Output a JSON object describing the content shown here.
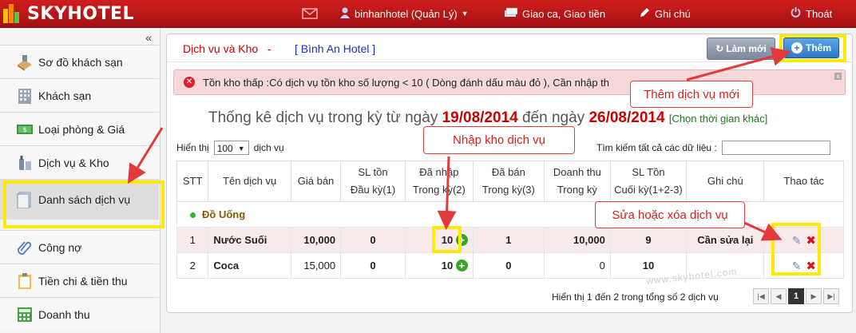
{
  "topbar": {
    "logo_text": "SKYHOTEL",
    "user": "binhanhotel (Quản Lý)",
    "shift": "Giao ca, Giao tiền",
    "notes": "Ghi chú",
    "logout": "Thoát"
  },
  "sidebar": {
    "collapse": "«",
    "items": [
      {
        "label": "Sơ đồ khách sạn"
      },
      {
        "label": "Khách sạn"
      },
      {
        "label": "Loại phòng & Giá"
      },
      {
        "label": "Dịch vụ & Kho"
      },
      {
        "label": "Danh sách dịch vụ"
      },
      {
        "label": "Công nợ"
      },
      {
        "label": "Tiền chi & tiền thu"
      },
      {
        "label": "Doanh thu"
      }
    ]
  },
  "header": {
    "title": "Dịch vụ và Kho",
    "sep": "-",
    "hotel": "[ Bình An Hotel ]",
    "refresh_label": "Làm mới",
    "add_label": "Thêm"
  },
  "alert": {
    "message": "Tồn kho thấp :Có dịch vụ tồn kho số lượng < 10 ( Dòng đánh dấu màu đỏ ), Cần nhập th",
    "close": "x"
  },
  "stats": {
    "prefix": "Thống kê dịch vụ trong kỳ từ ngày",
    "from": "19/08/2014",
    "mid": "đến ngày",
    "to": "26/08/2014",
    "link": "[Chọn thời gian khác]"
  },
  "controls": {
    "show_label": "Hiển thị",
    "page_size": "100",
    "unit": "dịch vụ",
    "search_label": "Tìm kiếm tất cả các dữ liệu :"
  },
  "table": {
    "headers": [
      {
        "l1": "STT",
        "l2": ""
      },
      {
        "l1": "Tên dịch vụ",
        "l2": ""
      },
      {
        "l1": "Giá bán",
        "l2": ""
      },
      {
        "l1": "SL tồn",
        "l2": "Đầu kỳ(1)"
      },
      {
        "l1": "Đã nhập",
        "l2": "Trong kỳ(2)"
      },
      {
        "l1": "Đã bán",
        "l2": "Trong kỳ(3)"
      },
      {
        "l1": "Doanh thu",
        "l2": "Trong kỳ"
      },
      {
        "l1": "SL Tồn",
        "l2": "Cuối kỳ(1+2-3)"
      },
      {
        "l1": "Ghi chú",
        "l2": ""
      },
      {
        "l1": "Thao tác",
        "l2": ""
      }
    ],
    "group": "Đồ Uống",
    "rows": [
      {
        "stt": "1",
        "name": "Nước Suối",
        "price": "10,000",
        "open": "0",
        "imported": "10",
        "sold": "1",
        "revenue": "10,000",
        "close": "9",
        "note": "Cần sửa lại"
      },
      {
        "stt": "2",
        "name": "Coca",
        "price": "15,000",
        "open": "0",
        "imported": "10",
        "sold": "0",
        "revenue": "0",
        "close": "10",
        "note": ""
      }
    ]
  },
  "footer": {
    "info": "Hiển thị 1 đến 2 trong tổng số 2 dịch vụ",
    "current_page": "1",
    "watermark": "www.skyhotel.com"
  },
  "callouts": {
    "add": "Thêm dịch vụ mới",
    "import": "Nhập kho dịch vụ",
    "edit": "Sửa hoặc xóa dịch vụ"
  },
  "colors": {
    "topbar": "#b81414",
    "accent_red": "#cc0000",
    "highlight": "#ffea00"
  }
}
